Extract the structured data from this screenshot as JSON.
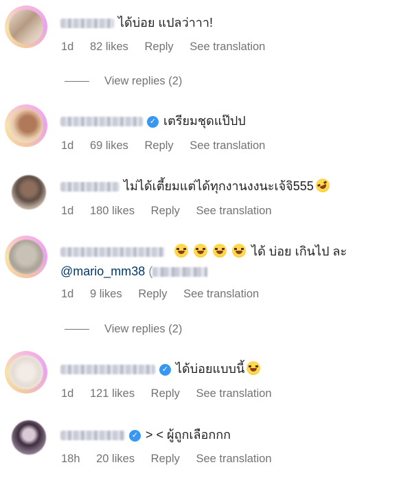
{
  "comments": [
    {
      "text": "ได้บ่อย แปลว่าาา!",
      "time": "1d",
      "likes": "82 likes",
      "reply": "Reply",
      "translate": "See translation",
      "verified": false,
      "view_replies": "View replies (2)"
    },
    {
      "text": "เตรียมชุดแป๊ปป",
      "time": "1d",
      "likes": "69 likes",
      "reply": "Reply",
      "translate": "See translation",
      "verified": true
    },
    {
      "text": "ไม่ได้เตี้ยมแต่ได้ทุกงานงงนะเจ้จิ555",
      "time": "1d",
      "likes": "180 likes",
      "reply": "Reply",
      "translate": "See translation",
      "verified": false
    },
    {
      "text": "ได้ บ่อย เกินไป ละ",
      "mention": "@mario_mm38",
      "time": "1d",
      "likes": "9 likes",
      "reply": "Reply",
      "translate": "See translation",
      "verified": false,
      "view_replies": "View replies (2)"
    },
    {
      "text": "ได้บ่อยแบบนี้",
      "time": "1d",
      "likes": "121 likes",
      "reply": "Reply",
      "translate": "See translation",
      "verified": true
    },
    {
      "text": "> < ผู้ถูกเลือกกก",
      "time": "18h",
      "likes": "20 likes",
      "reply": "Reply",
      "translate": "See translation",
      "verified": true
    }
  ],
  "colors": {
    "meta": "#737373",
    "verified": "#3897f0",
    "mention": "#00376b"
  },
  "icons": [
    "verified-badge-icon",
    "laughing-emoji-icon",
    "rofl-emoji-icon",
    "flushed-emoji-icon"
  ]
}
